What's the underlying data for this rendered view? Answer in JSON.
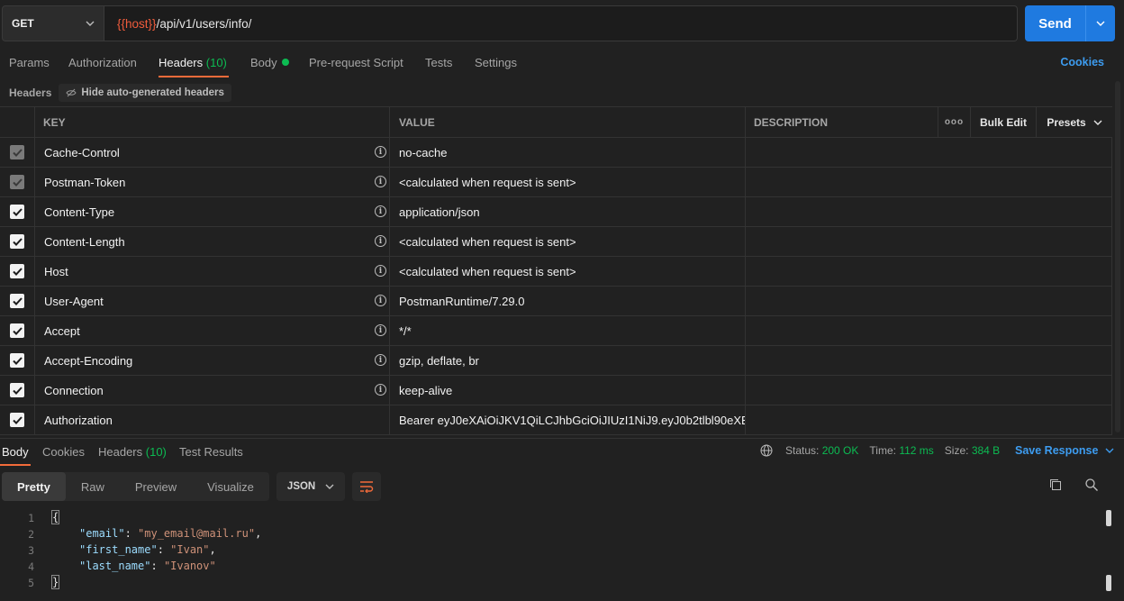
{
  "request": {
    "method": "GET",
    "url_var": "{{host}}",
    "url_path": "/api/v1/users/info/",
    "send_label": "Send"
  },
  "tabs": {
    "params": "Params",
    "authorization": "Authorization",
    "headers": "Headers",
    "headers_count": "(10)",
    "body": "Body",
    "prerequest": "Pre-request Script",
    "tests": "Tests",
    "settings": "Settings",
    "cookies": "Cookies"
  },
  "headers_section": {
    "title": "Headers",
    "hide_label": "Hide auto-generated headers"
  },
  "table": {
    "col_key": "KEY",
    "col_value": "VALUE",
    "col_desc": "DESCRIPTION",
    "more": "ooo",
    "bulk_edit": "Bulk Edit",
    "presets": "Presets",
    "rows": [
      {
        "key": "Cache-Control",
        "value": "no-cache",
        "checked": "dim"
      },
      {
        "key": "Postman-Token",
        "value": "<calculated when request is sent>",
        "checked": "dim"
      },
      {
        "key": "Content-Type",
        "value": "application/json",
        "checked": "on"
      },
      {
        "key": "Content-Length",
        "value": "<calculated when request is sent>",
        "checked": "on"
      },
      {
        "key": "Host",
        "value": "<calculated when request is sent>",
        "checked": "on"
      },
      {
        "key": "User-Agent",
        "value": "PostmanRuntime/7.29.0",
        "checked": "on"
      },
      {
        "key": "Accept",
        "value": "*/*",
        "checked": "on"
      },
      {
        "key": "Accept-Encoding",
        "value": "gzip, deflate, br",
        "checked": "on"
      },
      {
        "key": "Connection",
        "value": "keep-alive",
        "checked": "on"
      },
      {
        "key": "Authorization",
        "value": "Bearer eyJ0eXAiOiJKV1QiLCJhbGciOiJIUzI1NiJ9.eyJ0b2tlbl90eXB...",
        "checked": "on"
      }
    ]
  },
  "response": {
    "tab_body": "Body",
    "tab_cookies": "Cookies",
    "tab_headers": "Headers",
    "tab_headers_count": "(10)",
    "tab_tests": "Test Results",
    "status_label": "Status:",
    "status_value": "200 OK",
    "time_label": "Time:",
    "time_value": "112 ms",
    "size_label": "Size:",
    "size_value": "384 B",
    "save_label": "Save Response",
    "views": [
      "Pretty",
      "Raw",
      "Preview",
      "Visualize"
    ],
    "format": "JSON"
  },
  "code": {
    "line_numbers": [
      "1",
      "2",
      "3",
      "4",
      "5"
    ],
    "open": "{",
    "close": "}",
    "k1": "\"email\"",
    "v1": "\"my_email@mail.ru\"",
    "k2": "\"first_name\"",
    "v2": "\"Ivan\"",
    "k3": "\"last_name\"",
    "v3": "\"Ivanov\""
  }
}
